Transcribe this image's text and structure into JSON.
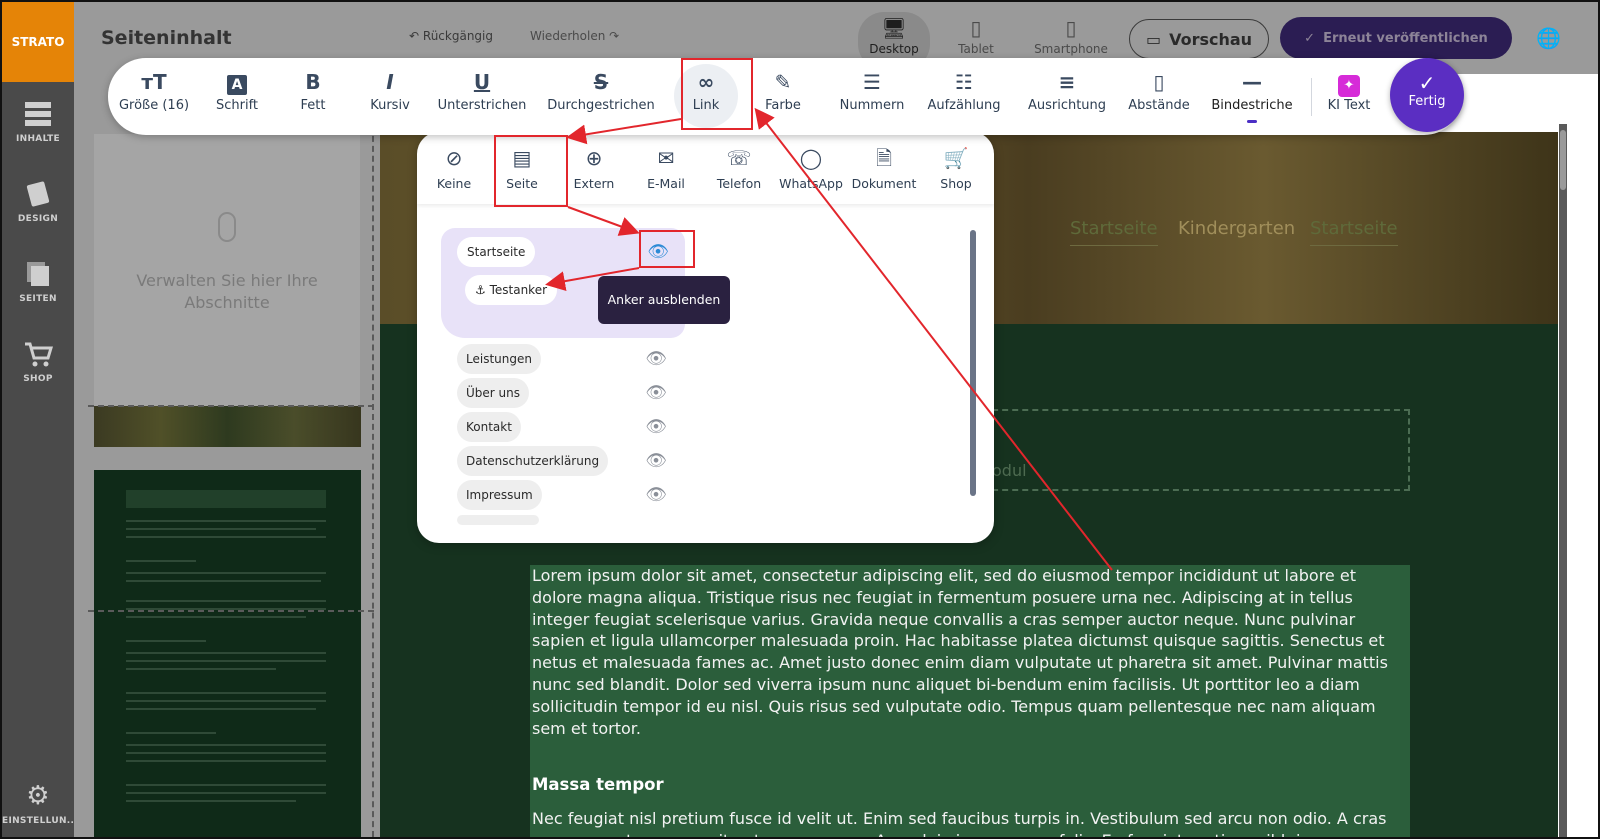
{
  "sidebar": {
    "logo": "STRATO",
    "items": [
      {
        "label": "INHALTE"
      },
      {
        "label": "DESIGN"
      },
      {
        "label": "SEITEN"
      },
      {
        "label": "SHOP"
      },
      {
        "label": "EINSTELLUN..."
      }
    ]
  },
  "topbar": {
    "title": "Seiteninhalt",
    "undo": "Rückgängig",
    "redo": "Wiederholen",
    "devices": [
      "Desktop",
      "Tablet",
      "Smartphone"
    ],
    "active_device": "Desktop",
    "preview": "Vorschau",
    "publish": "Erneut veröffentlichen"
  },
  "panel": {
    "hint": "Verwalten Sie hier Ihre Abschnitte"
  },
  "toolbar": {
    "buttons": [
      {
        "label": "Größe (16)",
        "icon": "font-size-icon"
      },
      {
        "label": "Schrift",
        "icon": "font-icon"
      },
      {
        "label": "Fett",
        "icon": "bold-icon"
      },
      {
        "label": "Kursiv",
        "icon": "italic-icon"
      },
      {
        "label": "Unterstrichen",
        "icon": "underline-icon"
      },
      {
        "label": "Durchgestrichen",
        "icon": "strikethrough-icon"
      },
      {
        "label": "Link",
        "icon": "link-icon"
      },
      {
        "label": "Farbe",
        "icon": "color-picker-icon"
      },
      {
        "label": "Nummern",
        "icon": "numbered-list-icon"
      },
      {
        "label": "Aufzählung",
        "icon": "bullet-list-icon"
      },
      {
        "label": "Ausrichtung",
        "icon": "align-icon"
      },
      {
        "label": "Abstände",
        "icon": "spacing-icon"
      },
      {
        "label": "Bindestriche",
        "icon": "hyphen-icon"
      },
      {
        "label": "KI Text",
        "icon": "ai-text-icon"
      }
    ],
    "done": "Fertig"
  },
  "link_popup": {
    "types": [
      {
        "label": "Keine",
        "icon": "none-icon"
      },
      {
        "label": "Seite",
        "icon": "page-icon"
      },
      {
        "label": "Extern",
        "icon": "globe-icon"
      },
      {
        "label": "E-Mail",
        "icon": "mail-icon"
      },
      {
        "label": "Telefon",
        "icon": "phone-icon"
      },
      {
        "label": "WhatsApp",
        "icon": "whatsapp-icon"
      },
      {
        "label": "Dokument",
        "icon": "document-icon"
      },
      {
        "label": "Shop",
        "icon": "cart-icon"
      }
    ],
    "selected_type": "Seite",
    "selected_page": "Startseite",
    "anchor": "Testanker",
    "tooltip": "Anker ausblenden",
    "pages": [
      "Leistungen",
      "Über uns",
      "Kontakt",
      "Datenschutzerklärung",
      "Impressum"
    ]
  },
  "site": {
    "nav": [
      "Startseite",
      "Kindergarten",
      "Startseite"
    ],
    "module_placeholder": "odul"
  },
  "content": {
    "paragraph1": "Lorem ipsum dolor sit amet, consectetur adipiscing elit, sed do eiusmod tempor incididunt ut labore et dolore magna aliqua. Tristique risus nec feugiat in fermentum posuere urna nec. Adipiscing at in tellus integer feugiat scelerisque varius. Gravida neque convallis a cras semper auctor neque. Nunc pulvinar sapien et ligula ullamcorper malesuada proin. Hac habitasse platea dictumst quisque sagittis. Senectus et netus et malesuada fames ac. Amet justo donec enim diam vulputate ut pharetra sit amet. Pulvinar mattis nunc sed blandit. Dolor sed viverra ipsum nunc aliquet bi-bendum enim facilisis. Ut porttitor leo a diam sollicitudin tempor id eu nisl. Quis risus sed vulputate odio. Tempus quam pellentesque nec nam aliquam sem et tortor.",
    "heading": "Massa tempor",
    "paragraph2": "Nec feugiat nisl pretium fusce id velit ut. Enim sed faucibus turpis in. Vestibulum sed arcu non odio. A cras semper auctor neque vitae tempus quam. Arcu dui vivamus arcu felis. Eu feugiat pretium nibh ipsum consequat. Risus nullam"
  },
  "colors": {
    "accent": "#5b2ec2",
    "annotation": "#e2262c",
    "text_selection": "#2b5e3b"
  }
}
